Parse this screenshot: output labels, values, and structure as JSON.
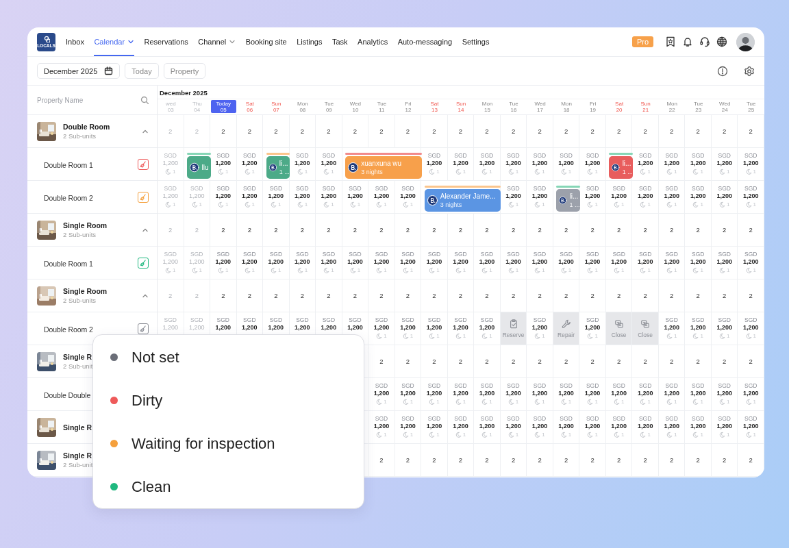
{
  "nav": {
    "logo_text": "LOCALS",
    "items": [
      {
        "label": "Inbox",
        "selected": false,
        "dropdown": false
      },
      {
        "label": "Calendar",
        "selected": true,
        "dropdown": true
      },
      {
        "label": "Reservations",
        "selected": false,
        "dropdown": false
      },
      {
        "label": "Channel",
        "selected": false,
        "dropdown": true
      },
      {
        "label": "Booking site",
        "selected": false,
        "dropdown": false
      },
      {
        "label": "Listings",
        "selected": false,
        "dropdown": false
      },
      {
        "label": "Task",
        "selected": false,
        "dropdown": false
      },
      {
        "label": "Analytics",
        "selected": false,
        "dropdown": false
      },
      {
        "label": "Auto-messaging",
        "selected": false,
        "dropdown": false
      },
      {
        "label": "Settings",
        "selected": false,
        "dropdown": false
      }
    ],
    "plan_badge": "Pro"
  },
  "toolbar": {
    "month": "December 2025",
    "buttons": [
      "Today",
      "Property"
    ]
  },
  "calendar": {
    "search_placeholder": "Property Name",
    "month": "December 2025",
    "days": [
      {
        "weekday": "wed",
        "day": "03",
        "today": false,
        "weekend": false,
        "past": true
      },
      {
        "weekday": "Thu",
        "day": "04",
        "today": false,
        "weekend": false,
        "past": true
      },
      {
        "weekday": "Today",
        "day": "05",
        "today": true,
        "weekend": false,
        "past": false
      },
      {
        "weekday": "Sat",
        "day": "06",
        "today": false,
        "weekend": true,
        "past": false
      },
      {
        "weekday": "Sun",
        "day": "07",
        "today": false,
        "weekend": true,
        "past": false
      },
      {
        "weekday": "Mon",
        "day": "08",
        "today": false,
        "weekend": false,
        "past": false
      },
      {
        "weekday": "Tue",
        "day": "09",
        "today": false,
        "weekend": false,
        "past": false
      },
      {
        "weekday": "Wed",
        "day": "10",
        "today": false,
        "weekend": false,
        "past": false
      },
      {
        "weekday": "Tue",
        "day": "11",
        "today": false,
        "weekend": false,
        "past": false
      },
      {
        "weekday": "Fri",
        "day": "12",
        "today": false,
        "weekend": false,
        "past": false
      },
      {
        "weekday": "Sat",
        "day": "13",
        "today": false,
        "weekend": true,
        "past": false
      },
      {
        "weekday": "Sun",
        "day": "14",
        "today": false,
        "weekend": true,
        "past": false
      },
      {
        "weekday": "Mon",
        "day": "15",
        "today": false,
        "weekend": false,
        "past": false
      },
      {
        "weekday": "Tue",
        "day": "16",
        "today": false,
        "weekend": false,
        "past": false
      },
      {
        "weekday": "Wed",
        "day": "17",
        "today": false,
        "weekend": false,
        "past": false
      },
      {
        "weekday": "Mon",
        "day": "18",
        "today": false,
        "weekend": false,
        "past": false
      },
      {
        "weekday": "Fri",
        "day": "19",
        "today": false,
        "weekend": false,
        "past": false
      },
      {
        "weekday": "Sat",
        "day": "20",
        "today": false,
        "weekend": true,
        "past": false
      },
      {
        "weekday": "Sun",
        "day": "21",
        "today": false,
        "weekend": true,
        "past": false
      },
      {
        "weekday": "Mon",
        "day": "22",
        "today": false,
        "weekend": false,
        "past": false
      },
      {
        "weekday": "Tue",
        "day": "23",
        "today": false,
        "weekend": false,
        "past": false
      },
      {
        "weekday": "Wed",
        "day": "24",
        "today": false,
        "weekend": false,
        "past": false
      },
      {
        "weekday": "Tue",
        "day": "25",
        "today": false,
        "weekend": false,
        "past": false
      }
    ],
    "rows": [
      {
        "kind": "group",
        "title": "Double Room",
        "subtitle": "2 Sub-units",
        "expanded": true,
        "cells": [
          "2",
          "2",
          "2",
          "2",
          "2",
          "2",
          "2",
          "2",
          "2",
          "2",
          "2",
          "2",
          "2",
          "2",
          "2",
          "2",
          "2",
          "2",
          "2",
          "2",
          "2",
          "2",
          "2"
        ]
      },
      {
        "kind": "unit",
        "name": "Double Room 1",
        "cleaning": {
          "color": "#ee5a5a"
        },
        "cells": [
          {
            "kind": "price",
            "currency": "SGD",
            "price": "1,200",
            "stay": "1"
          },
          {
            "kind": "booking",
            "guest": "llu",
            "color": "#4caa88",
            "status": {
              "color": "#86d6b6"
            }
          },
          {
            "kind": "price",
            "currency": "SGD",
            "price": "1,200",
            "stay": "1"
          },
          {
            "kind": "price",
            "currency": "SGD",
            "price": "1,200",
            "stay": "1"
          },
          {
            "kind": "booking",
            "guest": "li...",
            "detail": "1 ...",
            "color": "#4caa88",
            "status": {
              "color": "#fbc58c"
            }
          },
          {
            "kind": "price",
            "currency": "SGD",
            "price": "1,200",
            "stay": "1"
          },
          {
            "kind": "price",
            "currency": "SGD",
            "price": "1,200",
            "stay": "1"
          },
          {
            "kind": "covered"
          },
          {
            "kind": "booking",
            "guest": "xuanxuna wu",
            "detail": "3 nights",
            "color": "#f7a04b",
            "status": {
              "color": "#f28a8a"
            }
          },
          {
            "kind": "covered"
          },
          {
            "kind": "price",
            "currency": "SGD",
            "price": "1,200",
            "stay": "1"
          },
          {
            "kind": "price",
            "currency": "SGD",
            "price": "1,200",
            "stay": "1"
          },
          {
            "kind": "price",
            "currency": "SGD",
            "price": "1,200",
            "stay": "1"
          },
          {
            "kind": "price",
            "currency": "SGD",
            "price": "1,200",
            "stay": "1"
          },
          {
            "kind": "price",
            "currency": "SGD",
            "price": "1,200",
            "stay": "1"
          },
          {
            "kind": "price",
            "currency": "SGD",
            "price": "1,200",
            "stay": "1"
          },
          {
            "kind": "price",
            "currency": "SGD",
            "price": "1,200",
            "stay": "1"
          },
          {
            "kind": "booking",
            "guest": "li...",
            "detail": "1 ...",
            "color": "#e85d5d",
            "status": {
              "color": "#86d6b6"
            }
          },
          {
            "kind": "price",
            "currency": "SGD",
            "price": "1,200",
            "stay": "1"
          },
          {
            "kind": "price",
            "currency": "SGD",
            "price": "1,200",
            "stay": "1"
          },
          {
            "kind": "price",
            "currency": "SGD",
            "price": "1,200",
            "stay": "1"
          },
          {
            "kind": "price",
            "currency": "SGD",
            "price": "1,200",
            "stay": "1"
          },
          {
            "kind": "price",
            "currency": "SGD",
            "price": "1,200",
            "stay": "1"
          }
        ]
      },
      {
        "kind": "unit",
        "name": "Double Room 2",
        "cleaning": {
          "color": "#f5a03c"
        },
        "cells": [
          {
            "kind": "price",
            "currency": "SGD",
            "price": "1,200",
            "stay": "1"
          },
          {
            "kind": "price",
            "currency": "SGD",
            "price": "1,200",
            "stay": "1"
          },
          {
            "kind": "price",
            "currency": "SGD",
            "price": "1,200",
            "stay": "1"
          },
          {
            "kind": "price",
            "currency": "SGD",
            "price": "1,200",
            "stay": "1"
          },
          {
            "kind": "price",
            "currency": "SGD",
            "price": "1,200",
            "stay": "1"
          },
          {
            "kind": "price",
            "currency": "SGD",
            "price": "1,200",
            "stay": "1"
          },
          {
            "kind": "price",
            "currency": "SGD",
            "price": "1,200",
            "stay": "1"
          },
          {
            "kind": "price",
            "currency": "SGD",
            "price": "1,200",
            "stay": "1"
          },
          {
            "kind": "price",
            "currency": "SGD",
            "price": "1,200",
            "stay": "1"
          },
          {
            "kind": "price",
            "currency": "SGD",
            "price": "1,200",
            "stay": "1"
          },
          {
            "kind": "covered"
          },
          {
            "kind": "booking",
            "guest": "Alexander Jame...",
            "detail": "3 nights",
            "color": "#5b95e3",
            "status": {
              "color": "#fbc58c"
            }
          },
          {
            "kind": "covered"
          },
          {
            "kind": "price",
            "currency": "SGD",
            "price": "1,200",
            "stay": "1"
          },
          {
            "kind": "price",
            "currency": "SGD",
            "price": "1,200",
            "stay": "1"
          },
          {
            "kind": "booking",
            "guest": "li...",
            "detail": "1 ...",
            "color": "#9ca1ab",
            "status": {
              "color": "#86d6b6"
            }
          },
          {
            "kind": "price",
            "currency": "SGD",
            "price": "1,200",
            "stay": "1"
          },
          {
            "kind": "price",
            "currency": "SGD",
            "price": "1,200",
            "stay": "1"
          },
          {
            "kind": "price",
            "currency": "SGD",
            "price": "1,200",
            "stay": "1"
          },
          {
            "kind": "price",
            "currency": "SGD",
            "price": "1,200",
            "stay": "1"
          },
          {
            "kind": "price",
            "currency": "SGD",
            "price": "1,200",
            "stay": "1"
          },
          {
            "kind": "price",
            "currency": "SGD",
            "price": "1,200",
            "stay": "1"
          },
          {
            "kind": "price",
            "currency": "SGD",
            "price": "1,200",
            "stay": "1"
          }
        ]
      },
      {
        "kind": "group",
        "title": "Single Room",
        "subtitle": "2 Sub-units",
        "expanded": true,
        "cells": [
          "2",
          "2",
          "2",
          "2",
          "2",
          "2",
          "2",
          "2",
          "2",
          "2",
          "2",
          "2",
          "2",
          "2",
          "2",
          "2",
          "2",
          "2",
          "2",
          "2",
          "2",
          "2",
          "2"
        ]
      },
      {
        "kind": "unit",
        "name": "Double Room 1",
        "cleaning": {
          "color": "#1fb87f"
        },
        "cells": [
          {
            "kind": "price",
            "currency": "SGD",
            "price": "1,200",
            "stay": "1"
          },
          {
            "kind": "price",
            "currency": "SGD",
            "price": "1,200",
            "stay": "1"
          },
          {
            "kind": "price",
            "currency": "SGD",
            "price": "1,200",
            "stay": "1"
          },
          {
            "kind": "price",
            "currency": "SGD",
            "price": "1,200",
            "stay": "1"
          },
          {
            "kind": "price",
            "currency": "SGD",
            "price": "1,200",
            "stay": "1"
          },
          {
            "kind": "price",
            "currency": "SGD",
            "price": "1,200",
            "stay": "1"
          },
          {
            "kind": "price",
            "currency": "SGD",
            "price": "1,200",
            "stay": "1"
          },
          {
            "kind": "price",
            "currency": "SGD",
            "price": "1,200",
            "stay": "1"
          },
          {
            "kind": "price",
            "currency": "SGD",
            "price": "1,200",
            "stay": "1"
          },
          {
            "kind": "price",
            "currency": "SGD",
            "price": "1,200",
            "stay": "1"
          },
          {
            "kind": "price",
            "currency": "SGD",
            "price": "1,200",
            "stay": "1"
          },
          {
            "kind": "price",
            "currency": "SGD",
            "price": "1,200",
            "stay": "1"
          },
          {
            "kind": "price",
            "currency": "SGD",
            "price": "1,200",
            "stay": "1"
          },
          {
            "kind": "price",
            "currency": "SGD",
            "price": "1,200",
            "stay": "1"
          },
          {
            "kind": "price",
            "currency": "SGD",
            "price": "1,200",
            "stay": "1"
          },
          {
            "kind": "price",
            "currency": "SGD",
            "price": "1,200",
            "stay": "1"
          },
          {
            "kind": "price",
            "currency": "SGD",
            "price": "1,200",
            "stay": "1"
          },
          {
            "kind": "price",
            "currency": "SGD",
            "price": "1,200",
            "stay": "1"
          },
          {
            "kind": "price",
            "currency": "SGD",
            "price": "1,200",
            "stay": "1"
          },
          {
            "kind": "price",
            "currency": "SGD",
            "price": "1,200",
            "stay": "1"
          },
          {
            "kind": "price",
            "currency": "SGD",
            "price": "1,200",
            "stay": "1"
          },
          {
            "kind": "price",
            "currency": "SGD",
            "price": "1,200",
            "stay": "1"
          },
          {
            "kind": "price",
            "currency": "SGD",
            "price": "1,200",
            "stay": "1"
          }
        ]
      },
      {
        "kind": "group",
        "title": "Single Room",
        "subtitle": "2 Sub-units",
        "expanded": true,
        "cells": [
          "2",
          "2",
          "2",
          "2",
          "2",
          "2",
          "2",
          "2",
          "2",
          "2",
          "2",
          "2",
          "2",
          "2",
          "2",
          "2",
          "2",
          "2",
          "2",
          "2",
          "2",
          "2",
          "2"
        ]
      },
      {
        "kind": "unit",
        "name": "Double Room 2",
        "cleaning": {
          "color": "#8a8d95"
        },
        "cells": [
          {
            "kind": "price",
            "currency": "SGD",
            "price": "1,200"
          },
          {
            "kind": "price",
            "currency": "SGD",
            "price": "1,200"
          },
          {
            "kind": "price",
            "currency": "SGD",
            "price": "1,200"
          },
          {
            "kind": "price",
            "currency": "SGD",
            "price": "1,200"
          },
          {
            "kind": "price",
            "currency": "SGD",
            "price": "1,200"
          },
          {
            "kind": "price",
            "currency": "SGD",
            "price": "1,200"
          },
          {
            "kind": "price",
            "currency": "SGD",
            "price": "1,200"
          },
          {
            "kind": "price",
            "currency": "SGD",
            "price": "1,200"
          },
          {
            "kind": "price",
            "currency": "SGD",
            "price": "1,200",
            "stay": "1"
          },
          {
            "kind": "price",
            "currency": "SGD",
            "price": "1,200",
            "stay": "1"
          },
          {
            "kind": "price",
            "currency": "SGD",
            "price": "1,200",
            "stay": "1"
          },
          {
            "kind": "price",
            "currency": "SGD",
            "price": "1,200",
            "stay": "1"
          },
          {
            "kind": "price",
            "currency": "SGD",
            "price": "1,200",
            "stay": "1"
          },
          {
            "kind": "reserve",
            "label": "Reserve"
          },
          {
            "kind": "price",
            "currency": "SGD",
            "price": "1,200",
            "stay": "1"
          },
          {
            "kind": "repair",
            "label": "Repair"
          },
          {
            "kind": "price",
            "currency": "SGD",
            "price": "1,200",
            "stay": "1"
          },
          {
            "kind": "close",
            "label": "Close"
          },
          {
            "kind": "close",
            "label": "Close"
          },
          {
            "kind": "price",
            "currency": "SGD",
            "price": "1,200",
            "stay": "1"
          },
          {
            "kind": "price",
            "currency": "SGD",
            "price": "1,200",
            "stay": "1"
          },
          {
            "kind": "price",
            "currency": "SGD",
            "price": "1,200",
            "stay": "1"
          },
          {
            "kind": "price",
            "currency": "SGD",
            "price": "1,200",
            "stay": "1"
          }
        ]
      },
      {
        "kind": "group",
        "title": "Single R",
        "subtitle": "2 Sub-unit",
        "cells": [
          null,
          null,
          null,
          null,
          null,
          null,
          null,
          null,
          "2",
          "2",
          "2",
          "2",
          "2",
          "2",
          "2",
          "2",
          "2",
          "2",
          "2",
          "2",
          "2",
          "2",
          "2"
        ]
      },
      {
        "kind": "unit",
        "name": "Double Double",
        "cells": [
          null,
          null,
          null,
          null,
          null,
          null,
          null,
          null,
          {
            "kind": "price",
            "currency": "SGD",
            "price": "1,200",
            "stay": "1"
          },
          {
            "kind": "price",
            "currency": "SGD",
            "price": "1,200",
            "stay": "1"
          },
          {
            "kind": "price",
            "currency": "SGD",
            "price": "1,200",
            "stay": "1"
          },
          {
            "kind": "price",
            "currency": "SGD",
            "price": "1,200",
            "stay": "1"
          },
          {
            "kind": "price",
            "currency": "SGD",
            "price": "1,200",
            "stay": "1"
          },
          {
            "kind": "price",
            "currency": "SGD",
            "price": "1,200",
            "stay": "1"
          },
          {
            "kind": "price",
            "currency": "SGD",
            "price": "1,200",
            "stay": "1"
          },
          {
            "kind": "price",
            "currency": "SGD",
            "price": "1,200",
            "stay": "1"
          },
          {
            "kind": "price",
            "currency": "SGD",
            "price": "1,200",
            "stay": "1"
          },
          {
            "kind": "price",
            "currency": "SGD",
            "price": "1,200",
            "stay": "1"
          },
          {
            "kind": "price",
            "currency": "SGD",
            "price": "1,200",
            "stay": "1"
          },
          {
            "kind": "price",
            "currency": "SGD",
            "price": "1,200",
            "stay": "1"
          },
          {
            "kind": "price",
            "currency": "SGD",
            "price": "1,200",
            "stay": "1"
          },
          {
            "kind": "price",
            "currency": "SGD",
            "price": "1,200",
            "stay": "1"
          },
          {
            "kind": "price",
            "currency": "SGD",
            "price": "1,200",
            "stay": "1"
          }
        ]
      },
      {
        "kind": "group",
        "title": "Single R",
        "cells": [
          null,
          null,
          null,
          null,
          null,
          null,
          null,
          null,
          {
            "kind": "price",
            "currency": "SGD",
            "price": "1,200",
            "stay": "1"
          },
          {
            "kind": "price",
            "currency": "SGD",
            "price": "1,200",
            "stay": "1"
          },
          {
            "kind": "price",
            "currency": "SGD",
            "price": "1,200",
            "stay": "1"
          },
          {
            "kind": "price",
            "currency": "SGD",
            "price": "1,200",
            "stay": "1"
          },
          {
            "kind": "price",
            "currency": "SGD",
            "price": "1,200",
            "stay": "1"
          },
          {
            "kind": "price",
            "currency": "SGD",
            "price": "1,200",
            "stay": "1"
          },
          {
            "kind": "price",
            "currency": "SGD",
            "price": "1,200",
            "stay": "1"
          },
          {
            "kind": "price",
            "currency": "SGD",
            "price": "1,200",
            "stay": "1"
          },
          {
            "kind": "price",
            "currency": "SGD",
            "price": "1,200",
            "stay": "1"
          },
          {
            "kind": "price",
            "currency": "SGD",
            "price": "1,200",
            "stay": "1"
          },
          {
            "kind": "price",
            "currency": "SGD",
            "price": "1,200",
            "stay": "1"
          },
          {
            "kind": "price",
            "currency": "SGD",
            "price": "1,200",
            "stay": "1"
          },
          {
            "kind": "price",
            "currency": "SGD",
            "price": "1,200",
            "stay": "1"
          },
          {
            "kind": "price",
            "currency": "SGD",
            "price": "1,200",
            "stay": "1"
          },
          {
            "kind": "price",
            "currency": "SGD",
            "price": "1,200",
            "stay": "1"
          }
        ]
      },
      {
        "kind": "group",
        "title": "Single R",
        "subtitle": "2 Sub-unit",
        "cells": [
          null,
          null,
          null,
          null,
          null,
          null,
          null,
          null,
          "2",
          "2",
          "2",
          "2",
          "2",
          "2",
          "2",
          "2",
          "2",
          "2",
          "2",
          "2",
          "2",
          "2",
          "2"
        ]
      }
    ]
  },
  "legend": {
    "items": [
      {
        "label": "Not set",
        "color": "#6b6e78"
      },
      {
        "label": "Dirty",
        "color": "#ee5a5a"
      },
      {
        "label": "Waiting for inspection",
        "color": "#f5a03c"
      },
      {
        "label": "Clean",
        "color": "#1fb87f"
      }
    ]
  }
}
